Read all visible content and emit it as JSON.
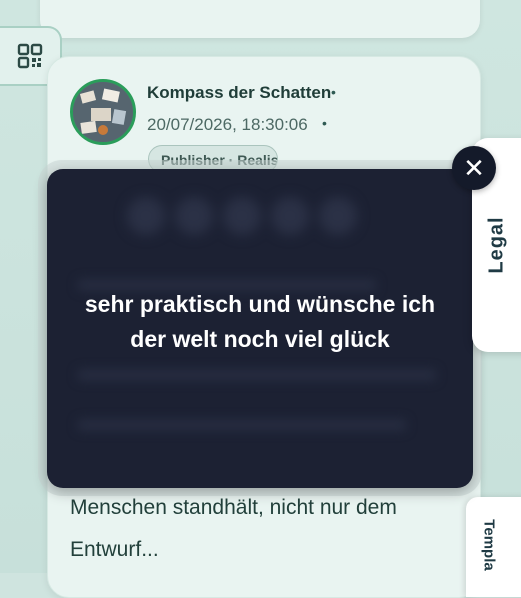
{
  "post": {
    "author": "Kompass der Schatten",
    "timestamp": "20/07/2026, 18:30:06",
    "tag": "Publisher · Realist",
    "body_line1": "Menschen standhält, nicht nur dem",
    "body_line2": "Entwurf..."
  },
  "toast": {
    "message_line1": "sehr praktisch und wünsche ich",
    "message_line2": "der welt noch viel glück"
  },
  "side_tabs": {
    "legal": "Legal",
    "templates": "Templa"
  },
  "colors": {
    "background": "#cfe4df",
    "card": "#e9f4f1",
    "toast": "#1c2133",
    "accent_green": "#2a9d5a"
  },
  "icons": {
    "grid": "grid-icon",
    "close": "close-icon",
    "separator": "•"
  }
}
